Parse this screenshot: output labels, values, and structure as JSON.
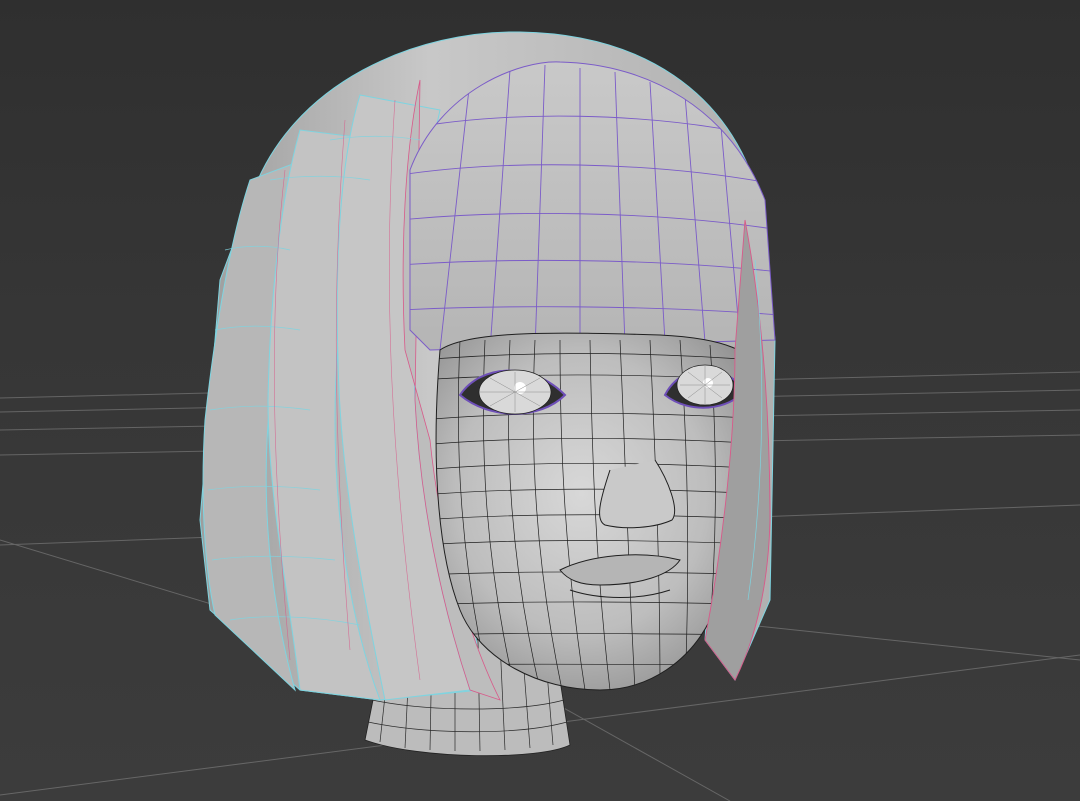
{
  "viewport": {
    "kind": "3d-perspective-viewport",
    "background_color": "#3b3b3b",
    "grid_color": "#8a8a8a",
    "model": "head-with-bob-hair-wireframe-on-shaded",
    "surface_color": "#b9b9b9",
    "wire_colors": {
      "hair_outer": "#7fd4e0",
      "hair_inner": "#d85a8a",
      "bangs": "#7b5cc8",
      "face": "#1f1f1f"
    }
  }
}
